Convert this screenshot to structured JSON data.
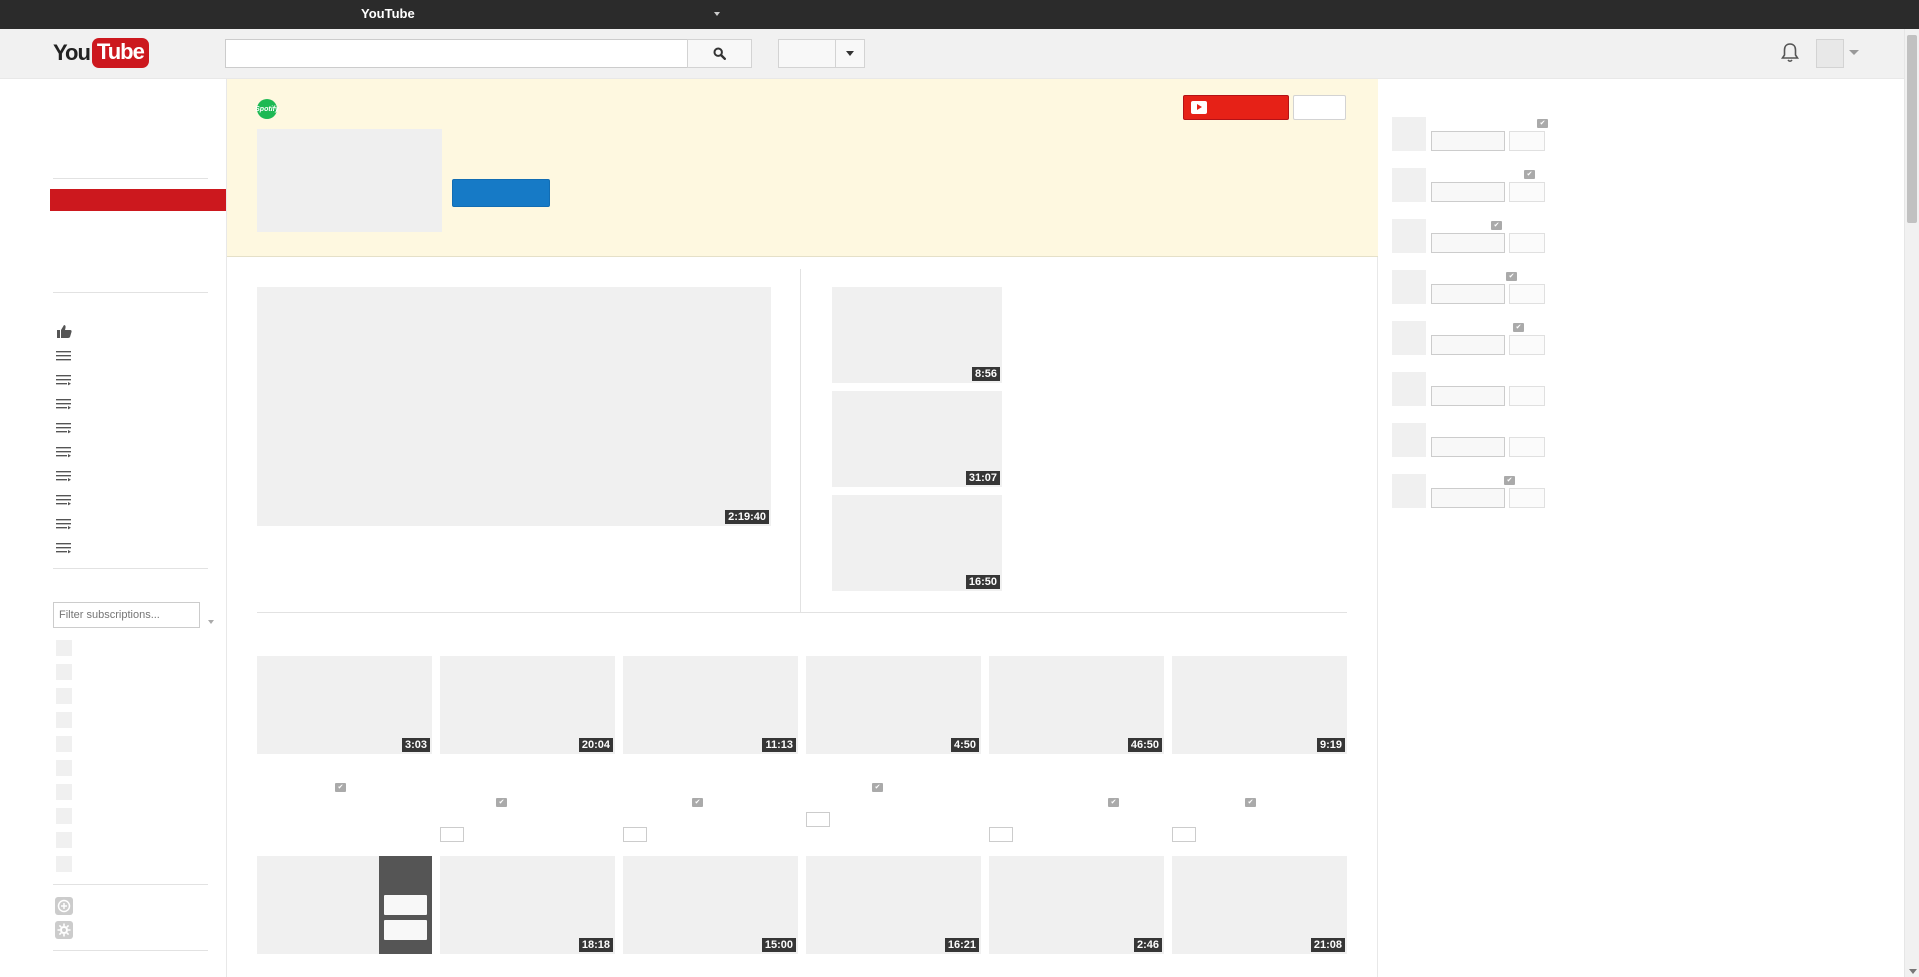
{
  "topbar": {
    "title": "YouTube"
  },
  "masthead": {
    "logo_you": "You",
    "logo_tube": "Tube",
    "search_placeholder": ""
  },
  "sidebar": {
    "filter_placeholder": "Filter subscriptions...",
    "icons": [
      "thumbs-up-icon",
      "playlist-icon",
      "playlist-icon",
      "playlist-icon",
      "playlist-icon",
      "playlist-icon",
      "playlist-icon",
      "playlist-icon",
      "playlist-icon",
      "playlist-icon"
    ],
    "bottom_icons": [
      "add-circle-icon",
      "gear-icon"
    ]
  },
  "banner": {
    "brand_badge": "Spotify"
  },
  "featured": {
    "main_duration": "2:19:40",
    "side_durations": [
      "8:56",
      "31:07",
      "16:50"
    ]
  },
  "grid": {
    "row1_durations": [
      "3:03",
      "20:04",
      "11:13",
      "4:50",
      "46:50",
      "9:19"
    ],
    "row2_durations": [
      "",
      "18:18",
      "15:00",
      "16:21",
      "2:46",
      "21:08"
    ]
  },
  "colors": {
    "accent_red": "#cc181e",
    "subscribe_red": "#e62117",
    "primary_blue": "#167ac6",
    "banner_bg": "#fef8e0",
    "topbar_bg": "#2b2b2b"
  }
}
